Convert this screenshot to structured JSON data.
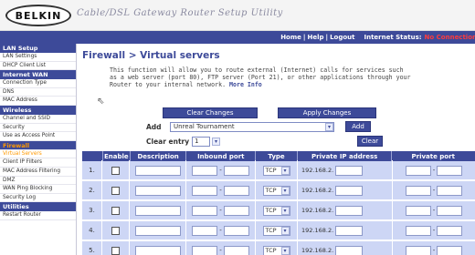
{
  "header": {
    "logo": "BELKIN",
    "app_title": "Cable/DSL Gateway Router Setup Utility",
    "links": {
      "home": "Home",
      "help": "Help",
      "logout": "Logout"
    },
    "internet_status_label": "Internet Status:",
    "internet_status_value": "No Connection"
  },
  "sidebar": {
    "sections": [
      {
        "title": "LAN Setup",
        "items": [
          "LAN Settings",
          "DHCP Client List"
        ]
      },
      {
        "title": "Internet WAN",
        "items": [
          "Connection Type",
          "DNS",
          "MAC Address"
        ]
      },
      {
        "title": "Wireless",
        "items": [
          "Channel and SSID",
          "Security",
          "Use as Access Point"
        ]
      },
      {
        "title": "Firewall",
        "items": [
          "Virtual Servers",
          "Client IP Filters",
          "MAC Address Filtering",
          "DMZ",
          "WAN Ping Blocking",
          "Security Log"
        ]
      },
      {
        "title": "Utilities",
        "items": [
          "Restart Router"
        ]
      }
    ],
    "active_section": "Firewall",
    "active_item": "Virtual Servers"
  },
  "main": {
    "breadcrumb": "Firewall > Virtual servers",
    "description": "This function will allow you to route external (Internet) calls for services such as a web server (port 80), FTP server (Port 21), or other applications through your Router to your internal network.",
    "more_info": "More Info",
    "buttons": {
      "clear_changes": "Clear Changes",
      "apply_changes": "Apply Changes",
      "add": "Add",
      "clear": "Clear"
    },
    "add_label": "Add",
    "add_selected": "Unreal Tournament",
    "clear_entry_label": "Clear entry",
    "clear_entry_selected": "1"
  },
  "table": {
    "headers": [
      "",
      "Enable",
      "Description",
      "Inbound port",
      "Type",
      "Private IP address",
      "Private port"
    ],
    "rows": [
      {
        "num": "1.",
        "type": "TCP",
        "ip_prefix": "192.168.2."
      },
      {
        "num": "2.",
        "type": "TCP",
        "ip_prefix": "192.168.2."
      },
      {
        "num": "3.",
        "type": "TCP",
        "ip_prefix": "192.168.2."
      },
      {
        "num": "4.",
        "type": "TCP",
        "ip_prefix": "192.168.2."
      },
      {
        "num": "5.",
        "type": "TCP",
        "ip_prefix": "192.168.2."
      }
    ]
  },
  "colors": {
    "accent": "#3d4a99",
    "row_bg": "#cdd6f5",
    "active_nav": "#ff9900",
    "status_red": "#ff3b3b"
  }
}
